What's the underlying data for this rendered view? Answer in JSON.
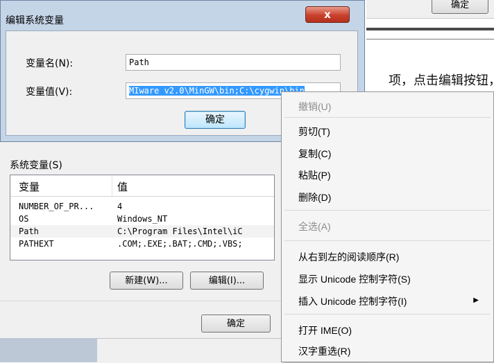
{
  "background": {
    "ok_button": "确定",
    "doc_text": "项，点击编辑按钮，"
  },
  "env_dialog": {
    "system_vars_title": "系统变量(S)",
    "columns": [
      "变量",
      "值"
    ],
    "rows": [
      {
        "name": "NUMBER_OF_PR...",
        "value": "4"
      },
      {
        "name": "OS",
        "value": "Windows_NT"
      },
      {
        "name": "Path",
        "value": "C:\\Program Files\\Intel\\iC"
      },
      {
        "name": "PATHEXT",
        "value": ".COM;.EXE;.BAT;.CMD;.VBS;"
      }
    ],
    "new_button": "新建(W)...",
    "edit_button": "编辑(I)...",
    "ok_button": "确定"
  },
  "edit_dialog": {
    "title": "编辑系统变量",
    "close_glyph": "x",
    "name_label": "变量名(N):",
    "name_value": "Path",
    "value_label": "变量值(V):",
    "value_selected": "MIware v2.0\\MinGW\\bin;C:\\cygwin\\bin",
    "ok_button": "确定"
  },
  "context_menu": {
    "items": [
      {
        "label": "撤销(U)",
        "disabled": true
      },
      {
        "label": "剪切(T)",
        "disabled": false
      },
      {
        "label": "复制(C)",
        "disabled": false
      },
      {
        "label": "粘贴(P)",
        "disabled": false
      },
      {
        "label": "删除(D)",
        "disabled": false
      },
      {
        "label": "全选(A)",
        "disabled": true
      },
      {
        "label": "从右到左的阅读顺序(R)",
        "disabled": false
      },
      {
        "label": "显示 Unicode 控制字符(S)",
        "disabled": false
      },
      {
        "label": "插入 Unicode 控制字符(I)",
        "disabled": false,
        "submenu": true
      },
      {
        "label": "打开 IME(O)",
        "disabled": false
      },
      {
        "label": "汉字重选(R)",
        "disabled": false
      }
    ],
    "submenu_arrow": "▶"
  }
}
